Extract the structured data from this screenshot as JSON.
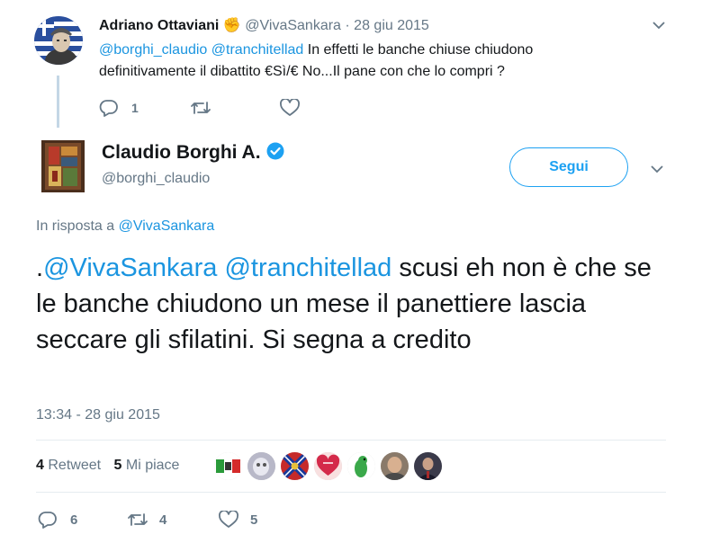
{
  "parent_tweet": {
    "author_name": "Adriano Ottaviani",
    "author_emoji": "✊",
    "author_handle": "@VivaSankara",
    "date_sep": "·",
    "date": "28 giu 2015",
    "mention_1": "@borghi_claudio",
    "mention_2": "@tranchitellad",
    "text_after": " In effetti le banche chiuse chiudono definitivamente il dibattito €Sì/€ No...Il pane con che lo compri ?",
    "reply_count": "1",
    "retweet_count": "",
    "like_count": ""
  },
  "main_tweet": {
    "author_name": "Claudio Borghi A.",
    "author_handle": "@borghi_claudio",
    "follow_label": "Segui",
    "reply_prefix": "In risposta a ",
    "reply_to": "@VivaSankara",
    "text_dot": ".",
    "mention_1": "@VivaSankara",
    "mention_2": "@tranchitellad",
    "text_after": " scusi eh non è che se le banche chiudono un mese il panettiere lascia seccare gli sfilatini. Si segna a credito",
    "timestamp": "13:34 - 28 giu 2015",
    "retweets_count": "4",
    "retweets_label": "Retweet",
    "likes_count": "5",
    "likes_label": "Mi piace",
    "reply_count": "6",
    "retweet_action_count": "4",
    "like_action_count": "5"
  },
  "colors": {
    "link": "#1b95e0",
    "muted": "#657786",
    "follow_blue": "#1da1f2",
    "verified_blue": "#1da1f2"
  }
}
